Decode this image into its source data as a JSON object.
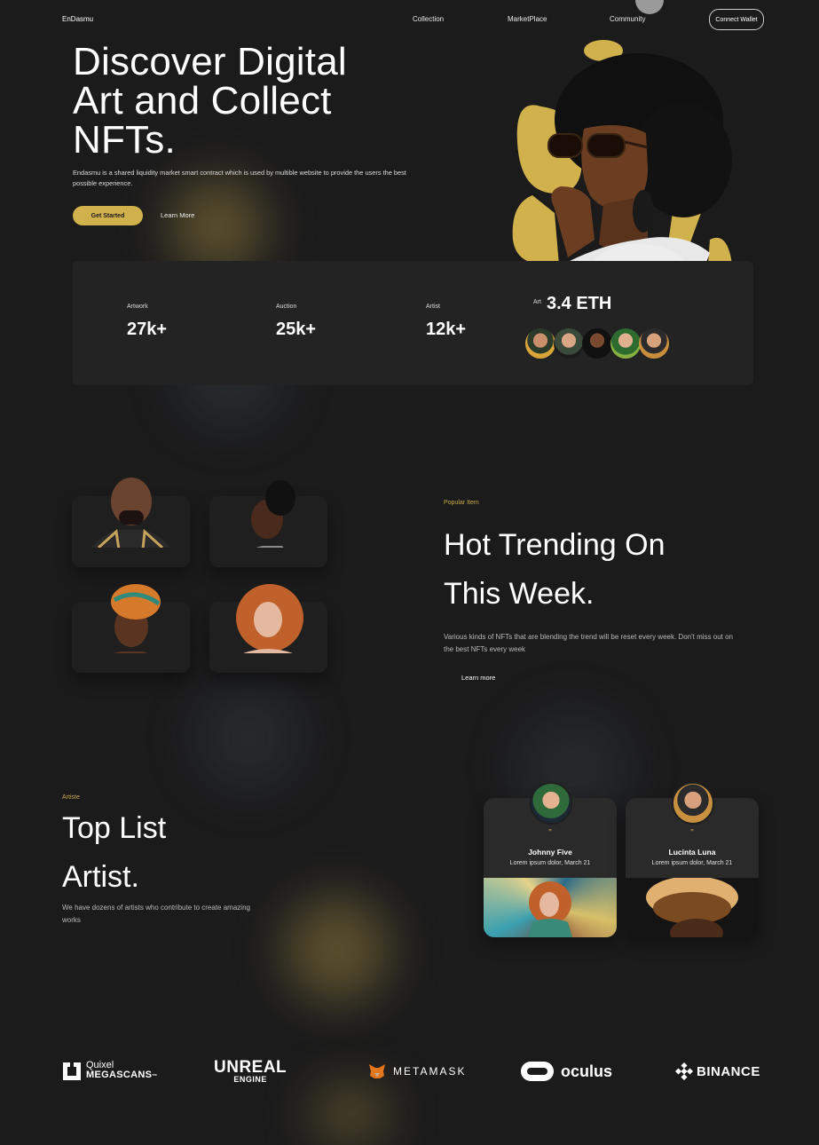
{
  "nav": {
    "logo": "EnDasmu",
    "links": [
      "Collection",
      "MarketPlace",
      "Community"
    ],
    "connect_wallet": "Connect Wallet"
  },
  "hero": {
    "title_lines": [
      "Discover Digital",
      "Art and Collect",
      "NFTs."
    ],
    "description": "Endasmu is a shared liquidity market smart contract which is used by multible website to provide the users the best possible experience.",
    "cta_primary": "Get Started",
    "cta_secondary": "Learn More"
  },
  "stats": {
    "items": [
      {
        "label": "Artwork",
        "value": "27k+"
      },
      {
        "label": "Auction",
        "value": "25k+"
      },
      {
        "label": "Artist",
        "value": "12k+"
      }
    ],
    "art": {
      "label": "Art",
      "value": "3.4 ETH"
    }
  },
  "trending": {
    "tag": "Popular Item",
    "title_lines": [
      "Hot Trending On",
      "This Week."
    ],
    "description": "Various kinds of NFTs that are blending the trend will be reset every week. Don't miss out on the best NFTs every week",
    "link": "Learn more"
  },
  "artists": {
    "tag": "Artiste",
    "title_lines": [
      "Top List",
      "Artist."
    ],
    "description": "We have dozens of artists who contribute to create amazing works",
    "cards": [
      {
        "quote": "\"",
        "name": "Johnny Five",
        "subtitle": "Lorem ipsum dolor, March 21"
      },
      {
        "quote": "\"",
        "name": "Lucinta Luna",
        "subtitle": "Lorem ipsum dolor, March 21"
      }
    ]
  },
  "partners": {
    "quixel_top": "Quixel",
    "quixel_bottom": "MEGASCANS",
    "quixel_tm": "™",
    "unreal_top": "UNREAL",
    "unreal_bottom": "ENGINE",
    "metamask": "METAMASK",
    "oculus": "oculus",
    "binance": "BINANCE"
  },
  "colors": {
    "background": "#1b1b1c",
    "accent": "#d1b14c",
    "card": "#232324"
  }
}
